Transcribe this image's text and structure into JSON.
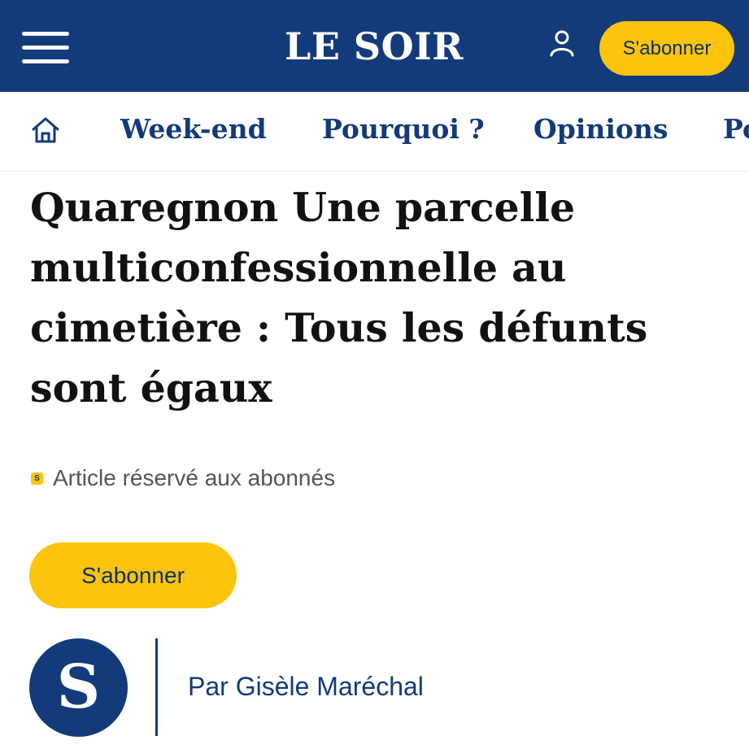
{
  "header": {
    "logo": "LE SOIR",
    "subscribe_label": "S'abonner",
    "menu_icon": "hamburger-menu-icon",
    "account_icon": "user-icon"
  },
  "nav": {
    "home_icon": "home-icon",
    "items": [
      {
        "label": "Week-end"
      },
      {
        "label": "Pourquoi ?"
      },
      {
        "label": "Opinions"
      },
      {
        "label": "Po"
      }
    ]
  },
  "article": {
    "headline": "Quaregnon Une parcelle multiconfessionnelle au cimetière : Tous les défunts sont égaux",
    "premium_badge": "S",
    "premium_label": "Article réservé aux abonnés",
    "subscribe_label": "S'abonner",
    "avatar_letter": "S",
    "author": "Par Gisèle Maréchal"
  },
  "colors": {
    "brand_blue": "#133a7a",
    "accent_yellow": "#fcc40a",
    "headline_text": "#111111",
    "muted_text": "#555555"
  }
}
